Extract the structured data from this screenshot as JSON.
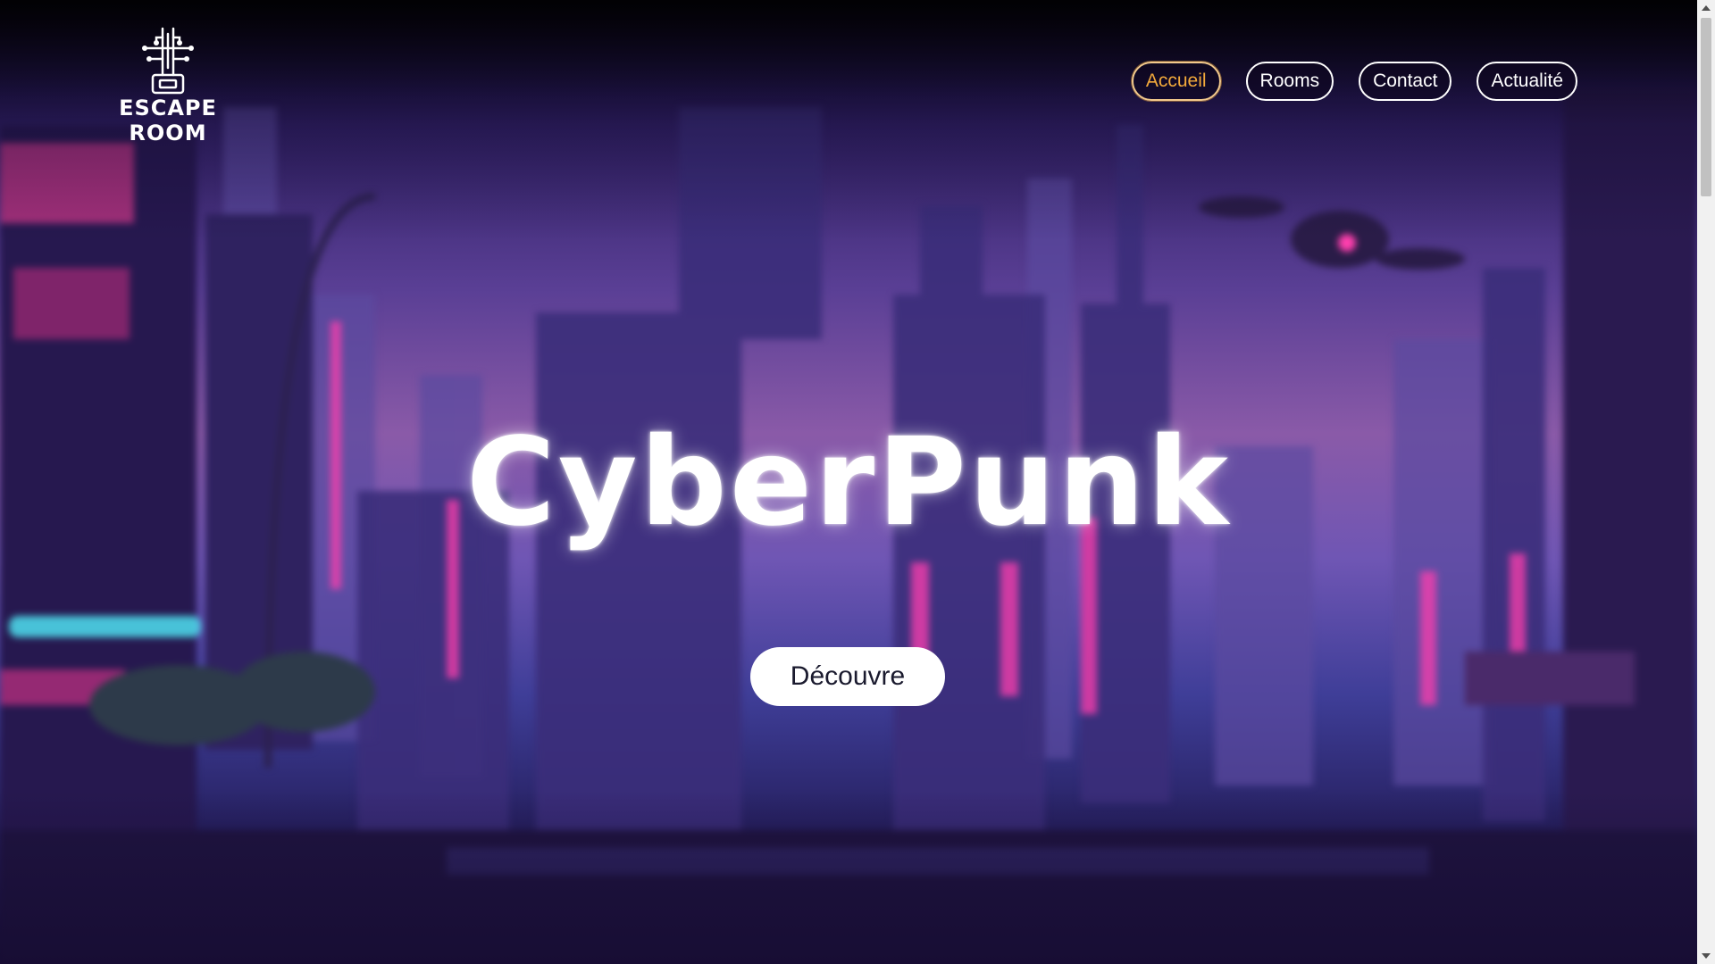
{
  "logo": {
    "line1": "ESCAPE",
    "line2": "ROOM"
  },
  "nav": {
    "items": [
      {
        "label": "Accueil",
        "active": true
      },
      {
        "label": "Rooms",
        "active": false
      },
      {
        "label": "Contact",
        "active": false
      },
      {
        "label": "Actualité",
        "active": false
      }
    ]
  },
  "hero": {
    "title": "CyberPunk",
    "cta_label": "Découvre"
  },
  "colors": {
    "active_nav": "#f2a93b",
    "button_bg": "#ffffff",
    "background": "#2a1b5e"
  }
}
